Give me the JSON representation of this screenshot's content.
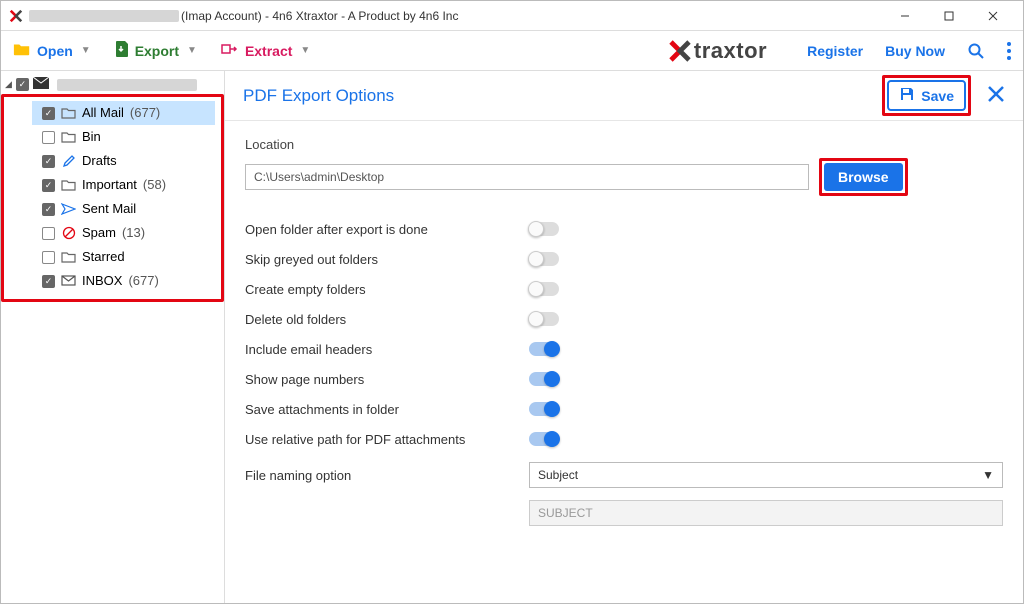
{
  "titlebar": {
    "suffix": "(Imap Account) - 4n6 Xtraxtor - A Product by 4n6 Inc"
  },
  "toolbar": {
    "open": "Open",
    "export": "Export",
    "extract": "Extract",
    "brand": "traxtor",
    "register": "Register",
    "buy": "Buy Now"
  },
  "sidebar": {
    "folders": [
      {
        "label": "All Mail",
        "count": "(677)",
        "checked": true,
        "selected": true,
        "icon": "folder"
      },
      {
        "label": "Bin",
        "count": "",
        "checked": false,
        "icon": "folder"
      },
      {
        "label": "Drafts",
        "count": "",
        "checked": true,
        "icon": "draft"
      },
      {
        "label": "Important",
        "count": "(58)",
        "checked": true,
        "icon": "folder"
      },
      {
        "label": "Sent Mail",
        "count": "",
        "checked": true,
        "icon": "sent"
      },
      {
        "label": "Spam",
        "count": "(13)",
        "checked": false,
        "icon": "spam"
      },
      {
        "label": "Starred",
        "count": "",
        "checked": false,
        "icon": "folder"
      },
      {
        "label": "INBOX",
        "count": "(677)",
        "checked": true,
        "icon": "inbox"
      }
    ]
  },
  "panel": {
    "title": "PDF Export Options",
    "save": "Save",
    "location_label": "Location",
    "location_value": "C:\\Users\\admin\\Desktop",
    "browse": "Browse",
    "options": [
      {
        "label": "Open folder after export is done",
        "on": false
      },
      {
        "label": "Skip greyed out folders",
        "on": false
      },
      {
        "label": "Create empty folders",
        "on": false
      },
      {
        "label": "Delete old folders",
        "on": false
      },
      {
        "label": "Include email headers",
        "on": true
      },
      {
        "label": "Show page numbers",
        "on": true
      },
      {
        "label": "Save attachments in folder",
        "on": true
      },
      {
        "label": "Use relative path for PDF attachments",
        "on": true
      }
    ],
    "naming_label": "File naming option",
    "naming_value": "Subject",
    "naming_disabled": "SUBJECT"
  }
}
